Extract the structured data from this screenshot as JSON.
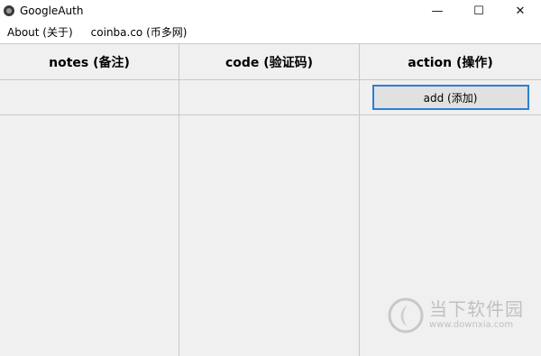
{
  "window": {
    "title": "GoogleAuth",
    "controls": {
      "minimize": "—",
      "maximize": "☐",
      "close": "✕"
    }
  },
  "menu": {
    "items": [
      {
        "label": "About (关于)"
      },
      {
        "label": "coinba.co (币多网)"
      }
    ]
  },
  "table": {
    "columns": [
      {
        "header": "notes (备注)"
      },
      {
        "header": "code (验证码)"
      },
      {
        "header": "action (操作)"
      }
    ],
    "add_button_label": "add (添加)"
  },
  "watermark": {
    "brand_text": "当下软件园",
    "url": "www.downxia.com"
  },
  "colors": {
    "accent_border": "#2d7fd2",
    "background": "#f0f0f0"
  }
}
